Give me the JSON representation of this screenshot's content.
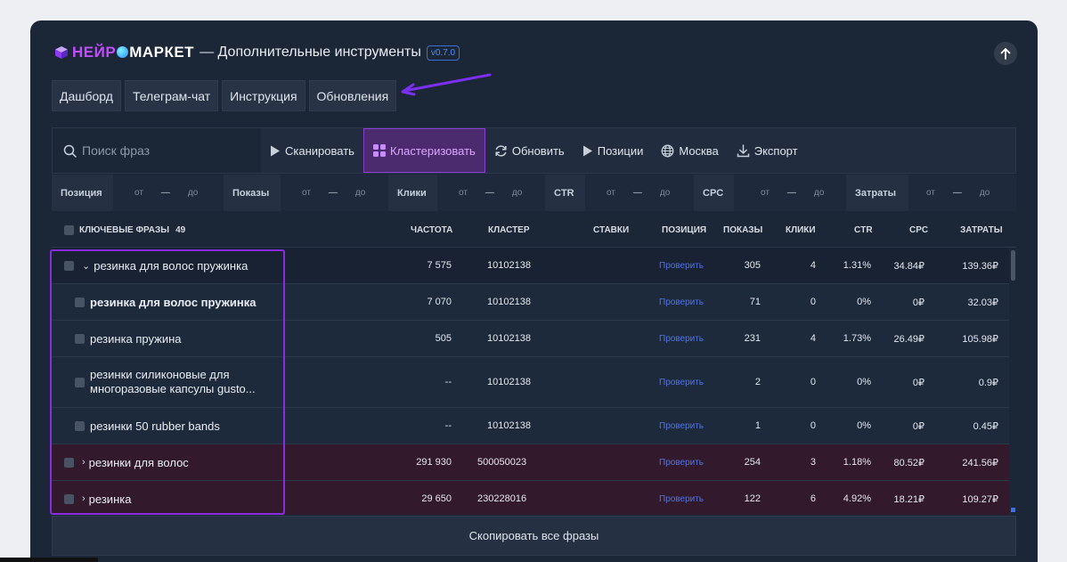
{
  "header": {
    "brand_part1": "НЕЙР",
    "brand_part2": "МАРКЕТ",
    "subtitle": "— Дополнительные инструменты",
    "version": "v0.7.0",
    "up_icon": "arrow-up-icon"
  },
  "nav": [
    {
      "label": "Дашборд"
    },
    {
      "label": "Телеграм-чат"
    },
    {
      "label": "Инструкция"
    },
    {
      "label": "Обновления"
    }
  ],
  "toolbar": {
    "search_placeholder": "Поиск фраз",
    "scan": "Сканировать",
    "cluster": "Кластеризовать",
    "refresh": "Обновить",
    "positions": "Позиции",
    "region": "Москва",
    "export": "Экспорт"
  },
  "filters": {
    "position": "Позиция",
    "shows": "Показы",
    "clicks": "Клики",
    "ctr": "CTR",
    "cpc": "CPC",
    "costs": "Затраты",
    "from": "от",
    "dash": "—",
    "to": "до"
  },
  "table": {
    "headers": {
      "keywords": "КЛЮЧЕВЫЕ ФРАЗЫ",
      "count": "49",
      "frequency": "ЧАСТОТА",
      "cluster": "КЛАСТЕР",
      "bids": "СТАВКИ",
      "position": "ПОЗИЦИЯ",
      "shows": "ПОКАЗЫ",
      "clicks": "КЛИКИ",
      "ctr": "CTR",
      "cpc": "CPC",
      "costs": "ЗАТРАТЫ"
    },
    "check_label": "Проверить",
    "rows": [
      {
        "phrase": "резинка для волос пружинка",
        "frequency": "7 575",
        "cluster": "10102138",
        "shows": "305",
        "clicks": "4",
        "ctr": "1.31%",
        "cpc": "34.84₽",
        "costs": "139.36₽"
      },
      {
        "phrase": "резинка для волос пружинка",
        "frequency": "7 070",
        "cluster": "10102138",
        "shows": "71",
        "clicks": "0",
        "ctr": "0%",
        "cpc": "0₽",
        "costs": "32.03₽"
      },
      {
        "phrase": "резинка пружина",
        "frequency": "505",
        "cluster": "10102138",
        "shows": "231",
        "clicks": "4",
        "ctr": "1.73%",
        "cpc": "26.49₽",
        "costs": "105.98₽"
      },
      {
        "phrase_line1": "резинки силиконовые для",
        "phrase_line2": "многоразовые капсулы gusto...",
        "frequency": "--",
        "cluster": "10102138",
        "shows": "2",
        "clicks": "0",
        "ctr": "0%",
        "cpc": "0₽",
        "costs": "0.9₽"
      },
      {
        "phrase": "резинки 50 rubber bands",
        "frequency": "--",
        "cluster": "10102138",
        "shows": "1",
        "clicks": "0",
        "ctr": "0%",
        "cpc": "0₽",
        "costs": "0.45₽"
      },
      {
        "phrase": "резинки для волос",
        "frequency": "291 930",
        "cluster": "500050023",
        "shows": "254",
        "clicks": "3",
        "ctr": "1.18%",
        "cpc": "80.52₽",
        "costs": "241.56₽"
      },
      {
        "phrase": "резинка",
        "frequency": "29 650",
        "cluster": "230228016",
        "shows": "122",
        "clicks": "6",
        "ctr": "4.92%",
        "cpc": "18.21₽",
        "costs": "109.27₽"
      }
    ]
  },
  "copy_all": "Скопировать все фразы",
  "colors": {
    "panel": "#1b2637",
    "accent_purple": "#8a2be2",
    "link_blue": "#4f73e6"
  }
}
